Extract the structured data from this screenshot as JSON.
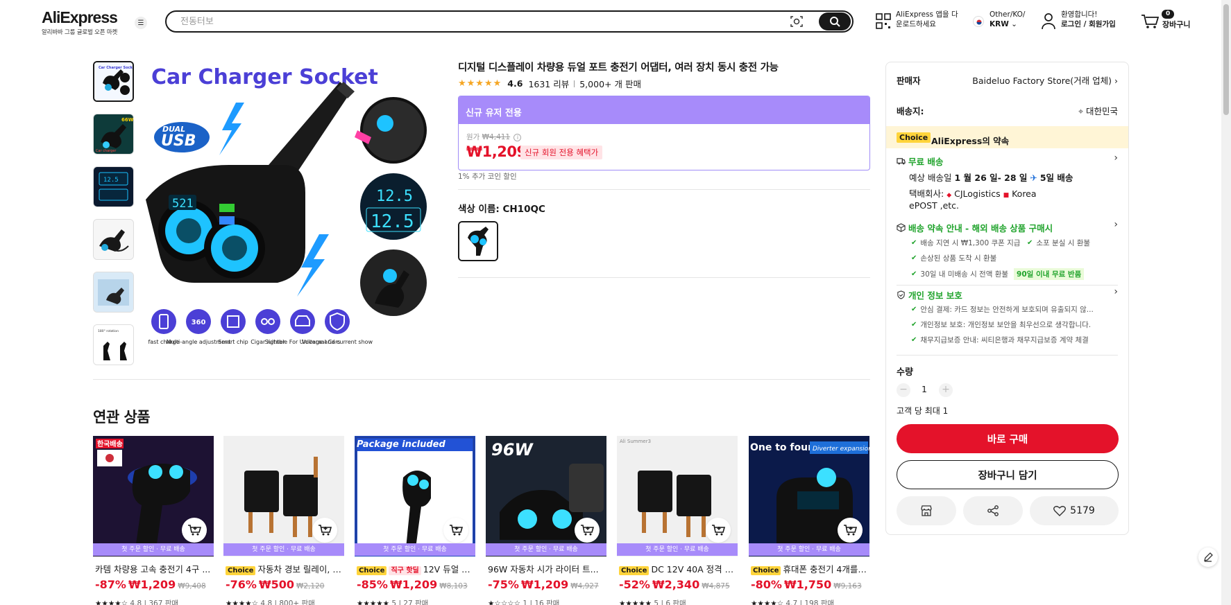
{
  "header": {
    "logo_text": "AliExpress",
    "logo_sub": "알리바바 그룹 글로벌 오픈 마켓",
    "search_placeholder": "전동터보",
    "app_line1": "AliExpress 앱을 다",
    "app_line2": "운로드하세요",
    "region_line1": "Other/KO/",
    "region_line2": "KRW",
    "user_line1": "환영합니다!",
    "user_line2": "로그인 / 회원가입",
    "cart_count": "0",
    "cart_label": "장바구니"
  },
  "product": {
    "title": "디지털 디스플레이 차량용 듀얼 포트 충전기 어댑터, 여러 장치 동시 충전 가능",
    "rating": 4.6,
    "rating_text": "4.6",
    "reviews": "1631 리뷰",
    "sold": "5,000+ 개 판매",
    "offer_header": "신규 유저 전용",
    "orig_label": "원가",
    "orig_price": "₩4,411",
    "sale_price": "₩1,209",
    "new_member_tag": "신규 회원 전용 혜택가",
    "coin_note": "1% 추가 코인 할인",
    "color_label": "색상 이름: CH10QC",
    "main_image_title": "Car Charger Socket",
    "main_image_badge": "DUAL USB",
    "main_image_display": "12.5",
    "feature_labels": [
      "fast charge",
      "Multi-angle adjustment",
      "Smart chip",
      "Cigar lighter",
      "Suitable For Univeraal Cars",
      "Voltage and current show"
    ]
  },
  "panel": {
    "seller_label": "판매자",
    "seller_value": "Baideluo Factory Store(거래 업체)",
    "ship_to_label": "배송지:",
    "ship_to_value": "대한민국",
    "choice_badge": "Choice",
    "promise_title": "AliExpress의 약속",
    "free_shipping": "무료 배송",
    "delivery_prefix": "예상 배송일",
    "delivery_dates": "1 월 26 일- 28 일",
    "delivery_days": "5일 배송",
    "carrier_label": "택배회사:",
    "carrier_1": "CJLogistics",
    "carrier_2": "Korea",
    "carrier_3": "ePOST ,etc.",
    "promise_guide": "배송 약속 안내 - 해외 배송 상품 구매시",
    "guide_items": [
      "배송 지연 시 ₩1,300 쿠폰 지급",
      "소포 분실 시 환불",
      "손상된 상품 도착 시 환불",
      "30일 내 미배송 시 전액 환불"
    ],
    "return_tag": "90일 이내 무료 반품",
    "privacy_title": "개인 정보 보호",
    "privacy_items": [
      "안심 결제: 카드 정보는 안전하게 보호되며 유출되지 않...",
      "개인정보 보호: 개인정보 보안을 최우선으로 생각합니다.",
      "채무지급보증 안내: 씨티은행과 채무지급보증 계약 체결"
    ],
    "qty_label": "수량",
    "qty_value": "1",
    "max_note": "고객 당 최대 1",
    "buy_now": "바로 구매",
    "add_cart": "장바구니 담기",
    "wish_count": "5179"
  },
  "related": {
    "title": "연관 상품",
    "strip_text": "첫 주문 할인 · 무료 배송",
    "items": [
      {
        "tag": "",
        "name": "카템 차량용 고속 충전기 4구 ...",
        "discount": "-87%",
        "price": "₩1,209",
        "orig": "₩9,408",
        "rating": "4.8",
        "sold": "367 판매",
        "stars": "★★★★☆"
      },
      {
        "tag": "Choice",
        "name": "자동차 경보 릴레이, D...",
        "discount": "-76%",
        "price": "₩500",
        "orig": "₩2,120",
        "rating": "4.8",
        "sold": "800+ 판매",
        "stars": "★★★★☆"
      },
      {
        "tag": "Choice",
        "tag2": "직구 핫딜",
        "name": "12V 듀얼 PD ...",
        "discount": "-85%",
        "price": "₩1,209",
        "orig": "₩8,103",
        "rating": "5",
        "sold": "27 판매",
        "stars": "★★★★★"
      },
      {
        "tag": "",
        "name": "96W 자동차 시가 라이터 트...",
        "discount": "-75%",
        "price": "₩1,209",
        "orig": "₩4,927",
        "rating": "1",
        "sold": "16 판매",
        "stars": "★☆☆☆☆"
      },
      {
        "tag": "Choice",
        "name": "DC 12V 40A 정격 전...",
        "discount": "-52%",
        "price": "₩2,340",
        "orig": "₩4,875",
        "rating": "5",
        "sold": "6 판매",
        "stars": "★★★★★"
      },
      {
        "tag": "Choice",
        "name": "휴대폰 충전기 4개를 ...",
        "discount": "-80%",
        "price": "₩1,750",
        "orig": "₩9,163",
        "rating": "4.7",
        "sold": "198 판매",
        "stars": "★★★★☆"
      }
    ],
    "img_texts": [
      "한국배송",
      "",
      "Package included",
      "96W",
      "Ali Summer3",
      "One to four"
    ]
  },
  "colors": {
    "accent_red": "#e4122a",
    "purple": "#a78bfa",
    "green": "#1fa32b",
    "choice_yellow": "#ffd43b"
  }
}
